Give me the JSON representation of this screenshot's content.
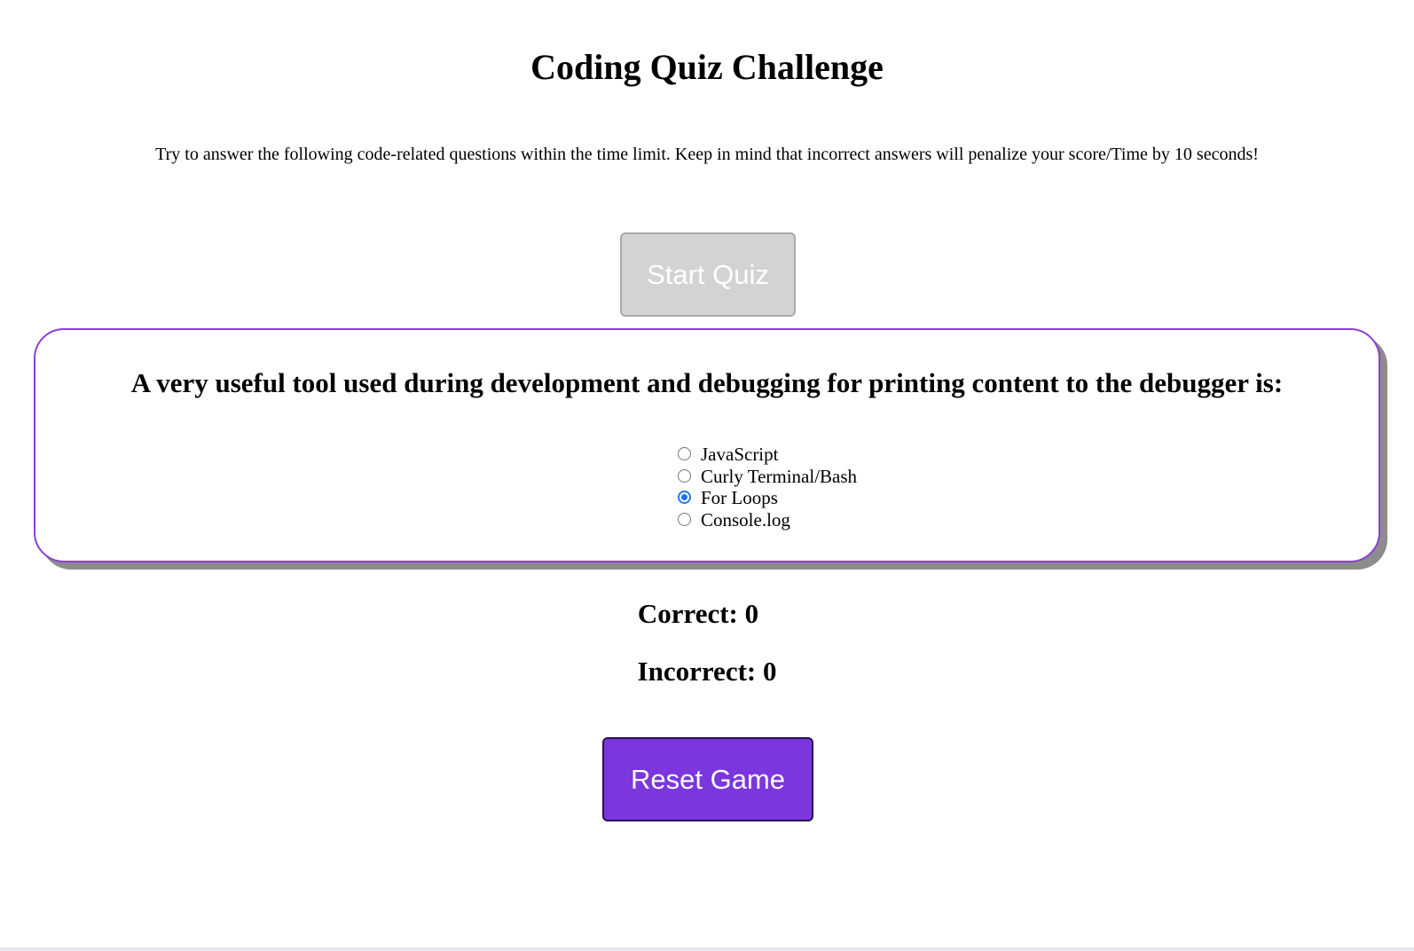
{
  "header": {
    "title": "Coding Quiz Challenge",
    "intro": "Try to answer the following code-related questions within the time limit. Keep in mind that incorrect answers will penalize your score/Time by 10 seconds!"
  },
  "controls": {
    "start_label": "Start Quiz",
    "reset_label": "Reset Game"
  },
  "quiz": {
    "question": "A very useful tool used during development and debugging for printing content to the debugger is:",
    "options": [
      {
        "label": "JavaScript",
        "selected": false
      },
      {
        "label": "Curly Terminal/Bash",
        "selected": false
      },
      {
        "label": "For Loops",
        "selected": true
      },
      {
        "label": "Console.log",
        "selected": false
      }
    ]
  },
  "score": {
    "correct_text": "Correct: 0",
    "incorrect_text": "Incorrect: 0"
  },
  "colors": {
    "accent": "#7b36de",
    "card_border": "#8a3fd6",
    "disabled_button": "#d3d3d3",
    "radio_checked": "#1a73e8"
  }
}
